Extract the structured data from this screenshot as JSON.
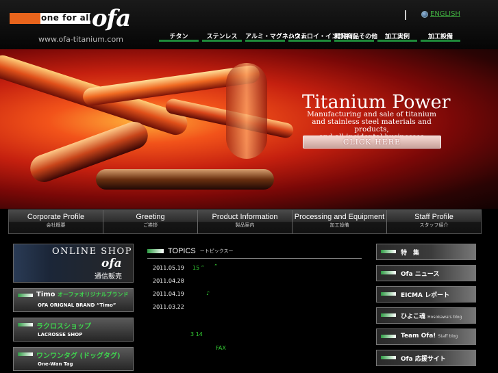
{
  "header": {
    "logo_tag": "one for all",
    "logo_word": "ofa",
    "site_url": "www.ofa-titanium.com",
    "lang_link": "ENGLISH",
    "nav": [
      "チタン",
      "ステンレス",
      "アルミ・マグネシウム",
      "ハステロイ・インコネル",
      "開発商品その他",
      "加工実例",
      "加工設備"
    ]
  },
  "hero": {
    "title": "Titanium Power",
    "subtitle_lines": [
      "Manufacturing and sale of titanium",
      "and stainless steel materials and products,",
      "and all incidental businesses"
    ],
    "button": "CLICK HERE"
  },
  "section_nav": [
    {
      "en": "Corporate Profile",
      "jp": "会社概要"
    },
    {
      "en": "Greeting",
      "jp": "ご挨拶"
    },
    {
      "en": "Product Information",
      "jp": "製品案内"
    },
    {
      "en": "Processing and Equipment",
      "jp": "加工設備"
    },
    {
      "en": "Staff Profile",
      "jp": "スタッフ紹介"
    }
  ],
  "left_banners": {
    "shop": {
      "title": "ONLINE SHOP",
      "logo": "ofa",
      "sub": "通信販売"
    },
    "items": [
      {
        "title": "Timo",
        "title_green": "オーファオリジナルブランド",
        "sub": "OFA ORIGNAL BRAND “Timo”"
      },
      {
        "title": "",
        "title_green": "ラクロスショップ",
        "sub": "LACROSSE SHOP"
      },
      {
        "title": "",
        "title_green": "ワンワンタグ (ドッグタグ)",
        "sub": "One-Wan Tag"
      }
    ]
  },
  "topics": {
    "title": "TOPICS",
    "subtitle": "ートピックスー",
    "dates": [
      "2011.05.19",
      "2011.04.28",
      "2011.04.19",
      "2011.03.22"
    ],
    "fragments": [
      "15 ”",
      "”",
      "♪",
      "3 14",
      "FAX"
    ]
  },
  "right_banners": [
    {
      "title": "特　集",
      "sub": ""
    },
    {
      "title": "Ofa ニュース",
      "sub": ""
    },
    {
      "title": "EICMA レポート",
      "sub": ""
    },
    {
      "title": "ひよこ魂",
      "sub": "Hosokawa's blog"
    },
    {
      "title": "Team Ofa!",
      "sub": "Staff blog"
    },
    {
      "title": "Ofa 応援サイト",
      "sub": ""
    }
  ],
  "colors": {
    "accent_green": "#1e8a3a",
    "link_green": "#3fae3f",
    "hero_red": "#c5200f",
    "brand_orange": "#e8641c"
  }
}
